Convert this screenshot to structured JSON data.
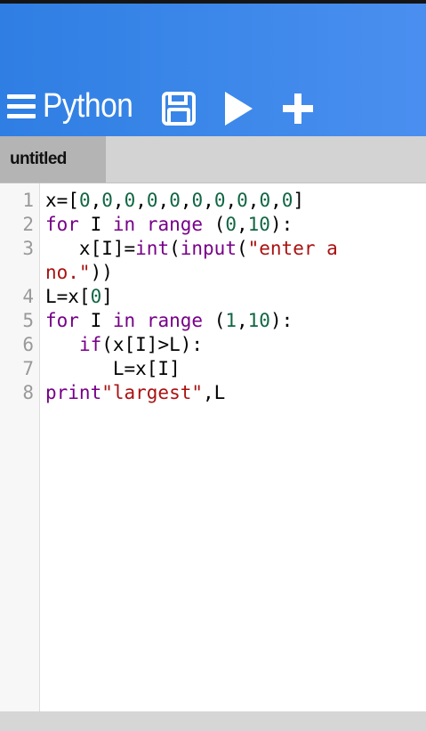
{
  "app": {
    "title": "Python",
    "toolbar_icons": [
      "menu-icon",
      "save-icon",
      "run-icon",
      "add-icon"
    ]
  },
  "colors": {
    "app_bar": "#3d88ea",
    "keyword": "#770088",
    "number": "#116644",
    "string": "#aa1111",
    "active_line": "#e8f2ff",
    "line_number": "#999999"
  },
  "tabs": [
    {
      "label": "untitled",
      "active": true
    }
  ],
  "editor": {
    "active_line": 8,
    "lines": [
      {
        "num": "1",
        "tokens": [
          {
            "t": "x=[",
            "c": "plain"
          },
          {
            "t": "0",
            "c": "number"
          },
          {
            "t": ",",
            "c": "plain"
          },
          {
            "t": "0",
            "c": "number"
          },
          {
            "t": ",",
            "c": "plain"
          },
          {
            "t": "0",
            "c": "number"
          },
          {
            "t": ",",
            "c": "plain"
          },
          {
            "t": "0",
            "c": "number"
          },
          {
            "t": ",",
            "c": "plain"
          },
          {
            "t": "0",
            "c": "number"
          },
          {
            "t": ",",
            "c": "plain"
          },
          {
            "t": "0",
            "c": "number"
          },
          {
            "t": ",",
            "c": "plain"
          },
          {
            "t": "0",
            "c": "number"
          },
          {
            "t": ",",
            "c": "plain"
          },
          {
            "t": "0",
            "c": "number"
          },
          {
            "t": ",",
            "c": "plain"
          },
          {
            "t": "0",
            "c": "number"
          },
          {
            "t": ",",
            "c": "plain"
          },
          {
            "t": "0",
            "c": "number"
          },
          {
            "t": "]",
            "c": "plain"
          }
        ]
      },
      {
        "num": "2",
        "tokens": [
          {
            "t": "for",
            "c": "keyword"
          },
          {
            "t": " I ",
            "c": "plain"
          },
          {
            "t": "in",
            "c": "keyword"
          },
          {
            "t": " ",
            "c": "plain"
          },
          {
            "t": "range",
            "c": "keyword"
          },
          {
            "t": " (",
            "c": "plain"
          },
          {
            "t": "0",
            "c": "number"
          },
          {
            "t": ",",
            "c": "plain"
          },
          {
            "t": "10",
            "c": "number"
          },
          {
            "t": "):",
            "c": "plain"
          }
        ]
      },
      {
        "num": "3",
        "tokens": [
          {
            "t": "   x[I]=",
            "c": "plain"
          },
          {
            "t": "int",
            "c": "keyword"
          },
          {
            "t": "(",
            "c": "plain"
          },
          {
            "t": "input",
            "c": "keyword"
          },
          {
            "t": "(",
            "c": "plain"
          },
          {
            "t": "\"enter a",
            "c": "string"
          }
        ]
      },
      {
        "num": "",
        "tokens": [
          {
            "t": "no.\"",
            "c": "string"
          },
          {
            "t": "))",
            "c": "plain"
          }
        ]
      },
      {
        "num": "4",
        "tokens": [
          {
            "t": "L=x[",
            "c": "plain"
          },
          {
            "t": "0",
            "c": "number"
          },
          {
            "t": "]",
            "c": "plain"
          }
        ]
      },
      {
        "num": "5",
        "tokens": [
          {
            "t": "for",
            "c": "keyword"
          },
          {
            "t": " I ",
            "c": "plain"
          },
          {
            "t": "in",
            "c": "keyword"
          },
          {
            "t": " ",
            "c": "plain"
          },
          {
            "t": "range",
            "c": "keyword"
          },
          {
            "t": " (",
            "c": "plain"
          },
          {
            "t": "1",
            "c": "number"
          },
          {
            "t": ",",
            "c": "plain"
          },
          {
            "t": "10",
            "c": "number"
          },
          {
            "t": "):",
            "c": "plain"
          }
        ]
      },
      {
        "num": "6",
        "tokens": [
          {
            "t": "   ",
            "c": "plain"
          },
          {
            "t": "if",
            "c": "keyword"
          },
          {
            "t": "(x[I]>L):",
            "c": "plain"
          }
        ]
      },
      {
        "num": "7",
        "tokens": [
          {
            "t": "      L=x[I]",
            "c": "plain"
          }
        ]
      },
      {
        "num": "8",
        "tokens": [
          {
            "t": "print",
            "c": "keyword"
          },
          {
            "t": "\"largest\"",
            "c": "string"
          },
          {
            "t": ",L",
            "c": "plain"
          }
        ]
      }
    ]
  }
}
